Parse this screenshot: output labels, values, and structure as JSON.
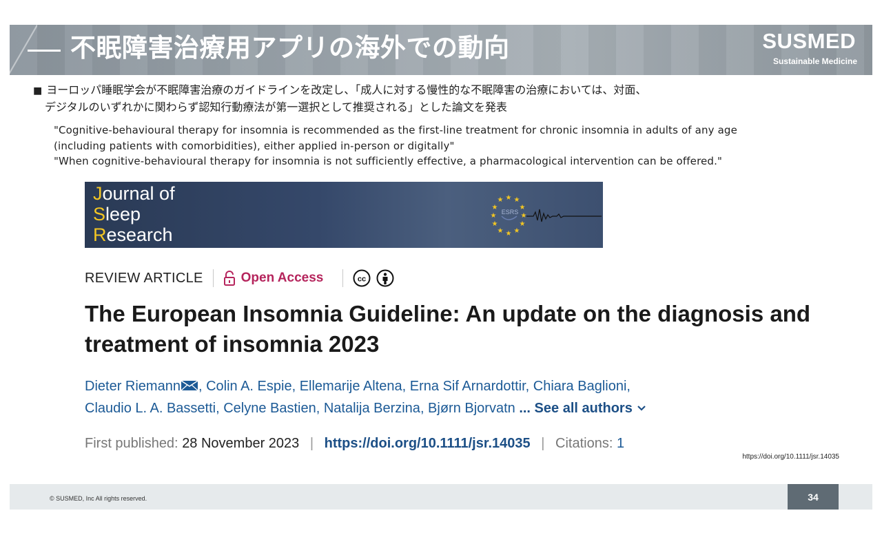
{
  "header": {
    "title": "不眠障害治療用アプリの海外での動向",
    "logo_main": "SUSMED",
    "logo_sub": "Sustainable Medicine"
  },
  "bullet": {
    "mark": "■",
    "line1": "ヨーロッパ睡眠学会が不眠障害治療のガイドラインを改定し、「成人に対する慢性的な不眠障害の治療においては、対面、",
    "line2": "デジタルのいずれかに関わらず認知行動療法が第一選択として推奨される」とした論文を発表"
  },
  "quotes": {
    "line1": "\"Cognitive-behavioural therapy for insomnia is recommended as the first-line treatment for chronic insomnia in adults of any age",
    "line2": "(including patients with comorbidities), either applied in-person or digitally\"",
    "line3": "\"When cognitive-behavioural therapy for insomnia is not sufficiently effective, a pharmacological intervention can be offered.\""
  },
  "journal": {
    "c1": "J",
    "r1": "ournal of",
    "c2": "S",
    "r2": "leep",
    "c3": "R",
    "r3": "esearch",
    "badge": "ESRS",
    "accent_color": "#f3c623"
  },
  "article": {
    "type_label": "REVIEW ARTICLE",
    "open_access": "Open Access",
    "title": "The European Insomnia Guideline: An update on the diagnosis and treatment of insomnia 2023",
    "authors_line1": [
      ", Colin A. Espie",
      ", Ellemarije Altena",
      ", Erna Sif Arnardottir",
      ", Chiara Baglioni,"
    ],
    "first_author": "Dieter Riemann",
    "authors_line2": [
      "Claudio L. A. Bassetti",
      ", Celyne Bastien",
      ", Natalija Berzina",
      ", Bjørn Bjorvatn"
    ],
    "see_all": " ... See all authors",
    "pub_key": "First published:",
    "pub_date": "28 November 2023",
    "doi": "https://doi.org/10.1111/jsr.14035",
    "citations_key": "Citations:",
    "citations_val": "1",
    "sep": "|"
  },
  "source_url": "https://doi.org/10.1111/jsr.14035",
  "footer": {
    "copyright": "© SUSMED, Inc All rights reserved.",
    "page_number": "34"
  },
  "colors": {
    "open_access": "#b5245c",
    "author_link": "#1c5a96",
    "doi_link": "#1c4f86",
    "page_box": "#5f6b74"
  }
}
